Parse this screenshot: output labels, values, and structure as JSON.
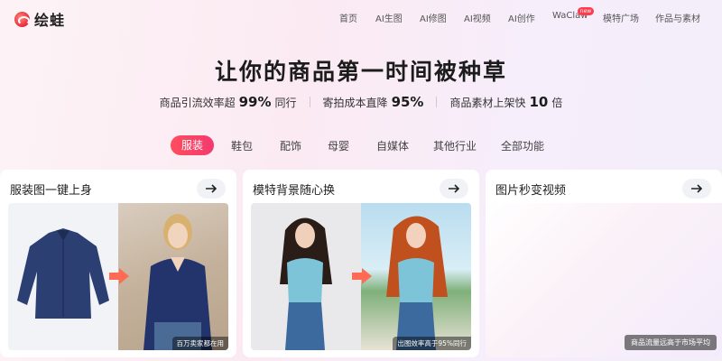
{
  "brand": {
    "name": "绘蛙",
    "logo_icon": "frog-logo-icon"
  },
  "nav": {
    "items": [
      {
        "label": "首页"
      },
      {
        "label": "AI生图"
      },
      {
        "label": "AI修图"
      },
      {
        "label": "AI视频"
      },
      {
        "label": "AI创作"
      },
      {
        "label": "WaClaw",
        "badge": "new"
      },
      {
        "label": "模特广场"
      },
      {
        "label": "作品与素材"
      }
    ]
  },
  "hero": {
    "title": "让你的商品第一时间被种草",
    "stats": [
      {
        "prefix": "商品引流效率超",
        "value": "99%",
        "suffix": "同行"
      },
      {
        "prefix": "寄拍成本直降",
        "value": "95%",
        "suffix": ""
      },
      {
        "prefix": "商品素材上架快",
        "value": "10",
        "suffix": "倍"
      }
    ]
  },
  "tabs": {
    "active": "服装",
    "items": [
      "服装",
      "鞋包",
      "配饰",
      "母婴",
      "自媒体",
      "其他行业",
      "全部功能"
    ]
  },
  "cards": [
    {
      "title": "服装图一键上身",
      "caption": "百万卖家都在用",
      "icon": "arrow-right-icon"
    },
    {
      "title": "模特背景随心换",
      "caption": "出图效率高于95%同行",
      "icon": "arrow-right-icon"
    },
    {
      "title": "图片秒变视频",
      "caption": "商品流量远高于市场平均",
      "icon": "arrow-right-icon"
    }
  ],
  "colors": {
    "accent": "#ff4d5f",
    "accent2": "#f23a6f",
    "shirt": "#2b3f73",
    "top": "#7ec4d9"
  }
}
